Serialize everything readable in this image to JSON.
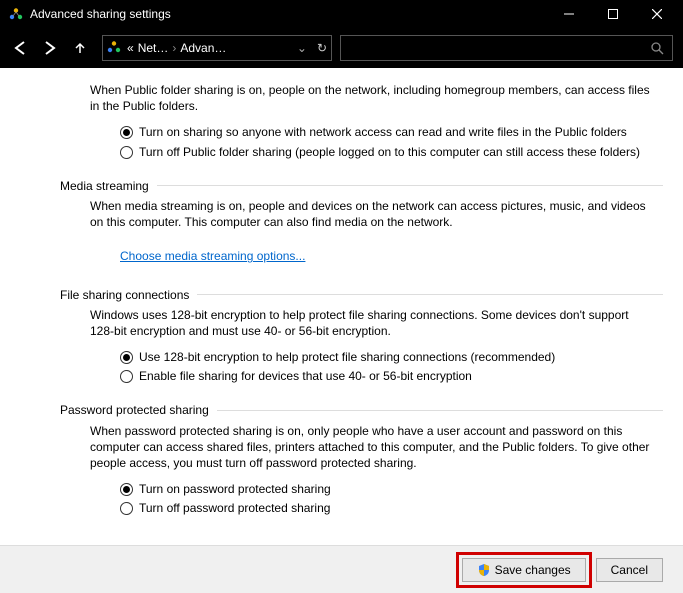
{
  "window": {
    "title": "Advanced sharing settings"
  },
  "breadcrumb": {
    "prefix": "«",
    "item1": "Net…",
    "item2": "Advan…"
  },
  "public_folder": {
    "desc": "When Public folder sharing is on, people on the network, including homegroup members, can access files in the Public folders.",
    "opt_on": "Turn on sharing so anyone with network access can read and write files in the Public folders",
    "opt_off": "Turn off Public folder sharing (people logged on to this computer can still access these folders)"
  },
  "media": {
    "header": "Media streaming",
    "desc": "When media streaming is on, people and devices on the network can access pictures, music, and videos on this computer. This computer can also find media on the network.",
    "link": "Choose media streaming options..."
  },
  "fileconn": {
    "header": "File sharing connections",
    "desc": "Windows uses 128-bit encryption to help protect file sharing connections. Some devices don't support 128-bit encryption and must use 40- or 56-bit encryption.",
    "opt_128": "Use 128-bit encryption to help protect file sharing connections (recommended)",
    "opt_40": "Enable file sharing for devices that use 40- or 56-bit encryption"
  },
  "password": {
    "header": "Password protected sharing",
    "desc": "When password protected sharing is on, only people who have a user account and password on this computer can access shared files, printers attached to this computer, and the Public folders. To give other people access, you must turn off password protected sharing.",
    "opt_on": "Turn on password protected sharing",
    "opt_off": "Turn off password protected sharing"
  },
  "footer": {
    "save": "Save changes",
    "cancel": "Cancel"
  }
}
